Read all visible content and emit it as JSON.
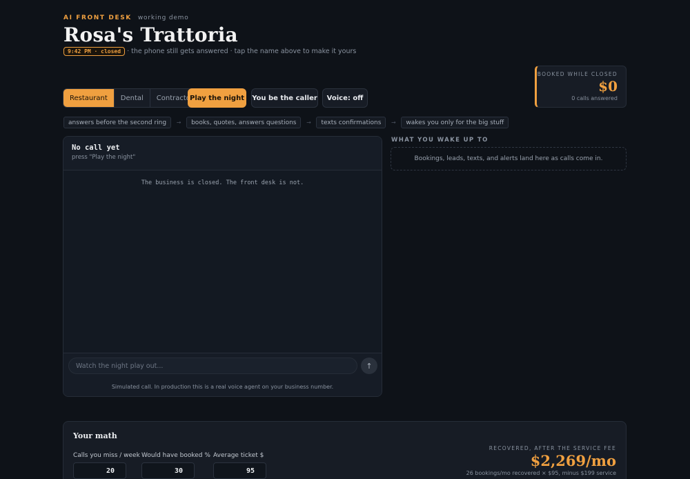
{
  "header": {
    "eyebrow": "AI FRONT DESK",
    "eyebrow_sub": "working demo",
    "title": "Rosa's Trattoria",
    "clock": "9:42 PM · closed",
    "subline": "· the phone still gets answered · tap the name above to make it yours"
  },
  "booked": {
    "label": "BOOKED WHILE CLOSED",
    "amount": "$0",
    "calls": "0 calls answered"
  },
  "business_types": [
    "Restaurant",
    "Dental",
    "Contractor"
  ],
  "business_types_selected": "Restaurant",
  "buttons": {
    "play": "Play the night",
    "caller": "You be the caller",
    "voice": "Voice: off"
  },
  "flow": {
    "steps": [
      "answers before the second ring",
      "books, quotes, answers questions",
      "texts confirmations",
      "wakes you only for the big stuff"
    ],
    "arrow": "→"
  },
  "call": {
    "title": "No call yet",
    "subtitle": "press \"Play the night\"",
    "body": "The business is closed. The front desk is not.",
    "input_placeholder": "Watch the night play out...",
    "send_icon": "↑",
    "footer": "Simulated call. In production this is a real voice agent on your business number."
  },
  "wake": {
    "label": "WHAT YOU WAKE UP TO",
    "empty": "Bookings, leads, texts, and alerts land here as calls come in."
  },
  "math": {
    "title": "Your math",
    "fields": [
      {
        "label": "Calls you miss / week",
        "value": "20"
      },
      {
        "label": "Would have booked %",
        "value": "30"
      },
      {
        "label": "Average ticket $",
        "value": "95"
      }
    ],
    "recovered_label": "RECOVERED, AFTER THE SERVICE FEE",
    "recovered_amount": "$2,269/mo",
    "recovered_note": "26 bookings/mo recovered × $95, minus $199 service"
  },
  "colors": {
    "accent": "#f0a040",
    "background": "#0e1218",
    "panel": "#131922"
  }
}
